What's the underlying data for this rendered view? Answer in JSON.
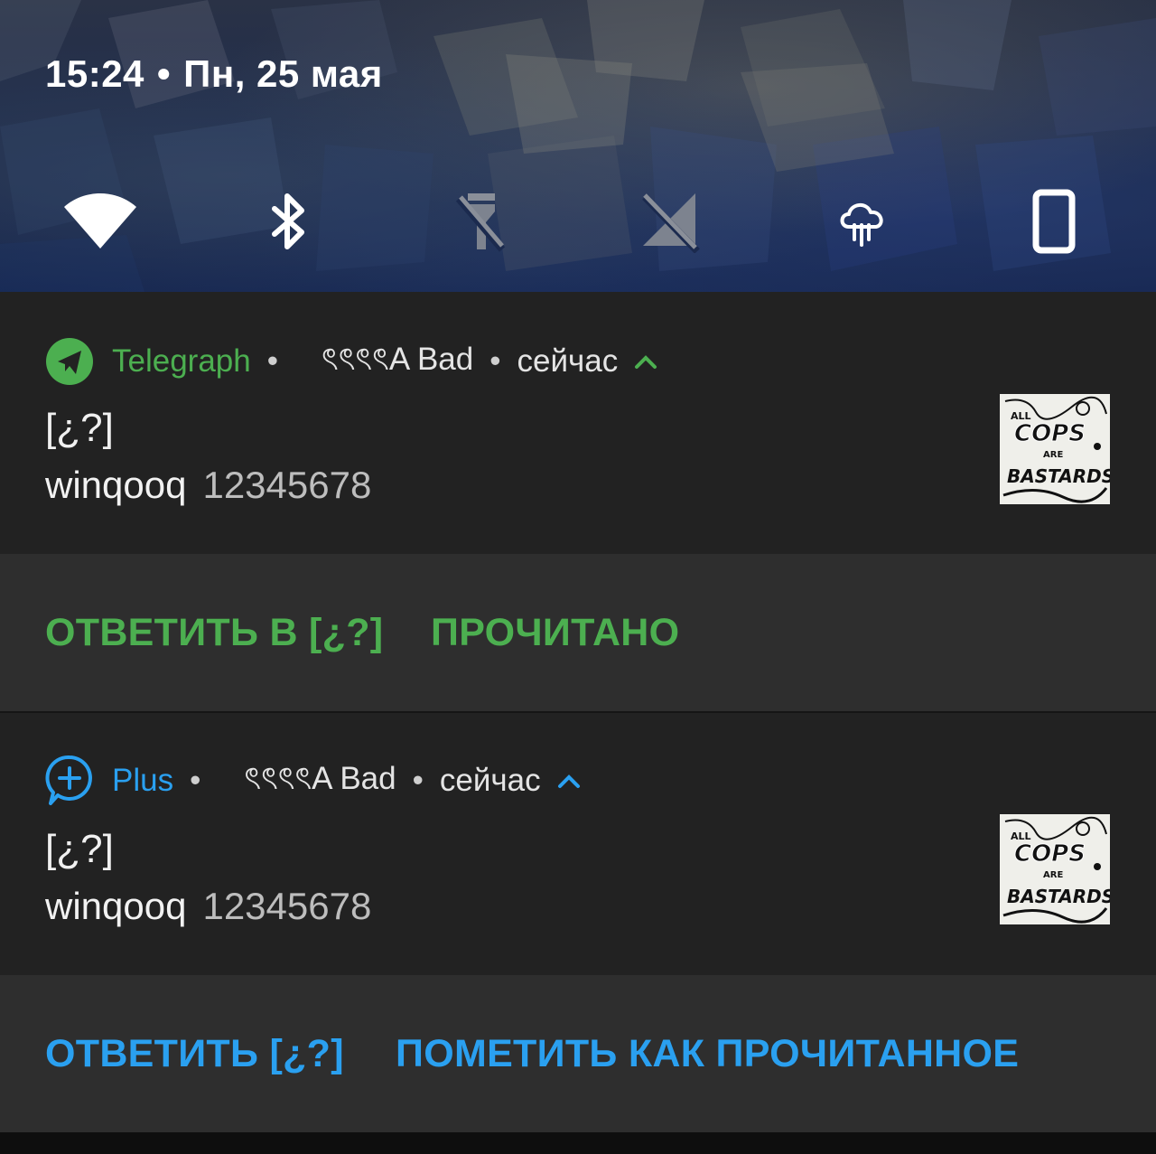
{
  "status": {
    "time": "15:24",
    "separator": "•",
    "date": "Пн, 25 мая"
  },
  "quick_tiles": [
    {
      "name": "wifi-icon",
      "active": true
    },
    {
      "name": "bluetooth-icon",
      "active": true
    },
    {
      "name": "flashlight-off-icon",
      "active": false
    },
    {
      "name": "mobile-data-off-icon",
      "active": false
    },
    {
      "name": "weather-rain-icon",
      "active": true
    },
    {
      "name": "screen-rotation-portrait-icon",
      "active": true
    }
  ],
  "notifications": [
    {
      "app_name": "Telegraph",
      "accent": "#4caf50",
      "app_icon": "telegram-plane-icon",
      "dot": "•",
      "sender_label": "ৎৎৎৎA Bad",
      "time_label": "сейчас",
      "title": "[¿?]",
      "sender": "winqooq",
      "message": "12345678",
      "thumbnail_icon": "sticker-thumbnail",
      "thumbnail_text": {
        "line1": "ALL",
        "line2": "COPS",
        "line3": "ARE",
        "line4": "BASTARDS"
      },
      "actions": [
        "ОТВЕТИТЬ В [¿?]",
        "ПРОЧИТАНО"
      ]
    },
    {
      "app_name": "Plus",
      "accent": "#2aa0f0",
      "app_icon": "plus-messenger-icon",
      "dot": "•",
      "sender_label": "ৎৎৎৎA Bad",
      "time_label": "сейчас",
      "title": "[¿?]",
      "sender": "winqooq",
      "message": "12345678",
      "thumbnail_icon": "sticker-thumbnail",
      "thumbnail_text": {
        "line1": "ALL",
        "line2": "COPS",
        "line3": "ARE",
        "line4": "BASTARDS"
      },
      "actions": [
        "ОТВЕТИТЬ [¿?]",
        "ПОМЕТИТЬ КАК ПРОЧИТАННОЕ"
      ]
    }
  ]
}
